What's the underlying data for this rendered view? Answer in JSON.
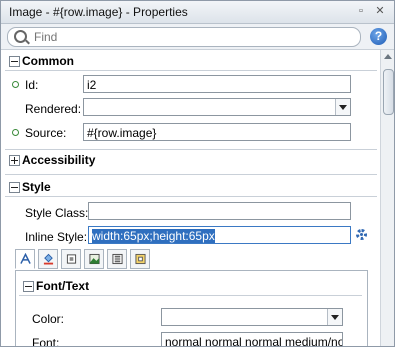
{
  "window": {
    "title": "Image - #{row.image} - Properties",
    "btn_a": "▫",
    "btn_b": "✕"
  },
  "search": {
    "placeholder": "Find",
    "help_label": "?"
  },
  "sections": {
    "common": "Common",
    "accessibility": "Accessibility",
    "style": "Style",
    "font_text": "Font/Text"
  },
  "common": {
    "id_label": "Id:",
    "id_value": "i2",
    "rendered_label": "Rendered:",
    "rendered_value": "",
    "source_label": "Source:",
    "source_value": "#{row.image}"
  },
  "style": {
    "style_class_label": "Style Class:",
    "style_class_value": "",
    "inline_style_label": "Inline Style:",
    "inline_style_value": "width:65px;height:65px"
  },
  "style_tabs": [
    {
      "icon": "text-style-icon"
    },
    {
      "icon": "paint-bucket-icon"
    },
    {
      "icon": "border-icon"
    },
    {
      "icon": "background-image-icon"
    },
    {
      "icon": "layout-icon"
    },
    {
      "icon": "box-model-icon"
    }
  ],
  "font_text": {
    "color_label": "Color:",
    "color_value": "",
    "font_label": "Font:",
    "font_value": "normal normal normal medium/normal"
  },
  "colors": {
    "accent": "#2f6fbf",
    "required": "#3a8a3a",
    "border": "#8c96a0"
  }
}
